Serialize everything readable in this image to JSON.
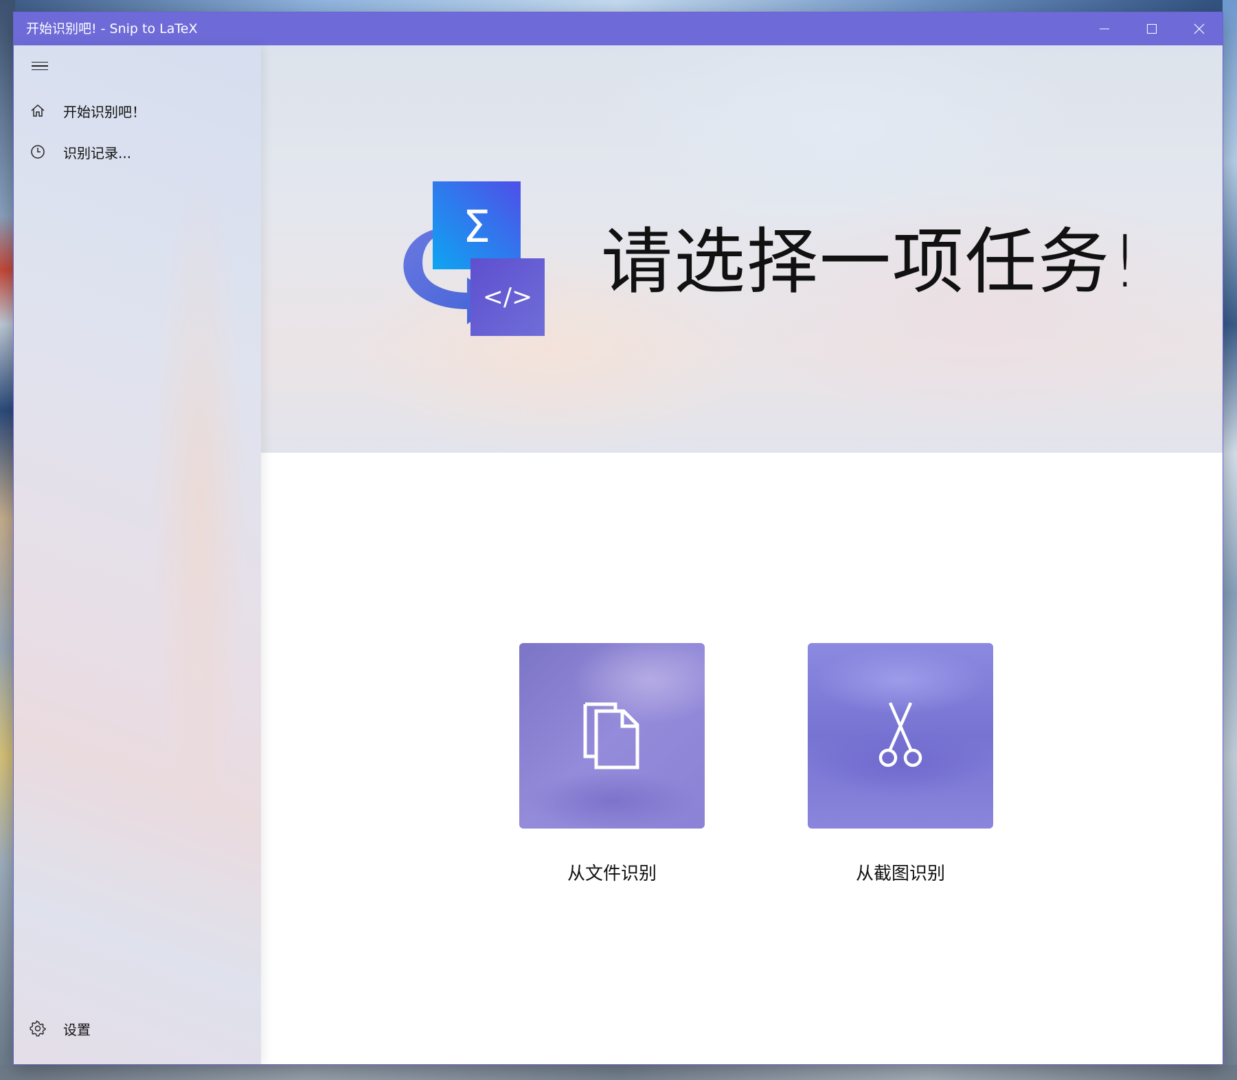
{
  "window": {
    "title": "开始识别吧! - Snip to LaTeX",
    "controls": {
      "minimize_icon": "minimize-icon",
      "maximize_icon": "maximize-icon",
      "close_icon": "close-icon"
    }
  },
  "sidebar": {
    "menu_icon": "hamburger-menu-icon",
    "items": [
      {
        "label": "开始识别吧！",
        "icon": "home-icon"
      },
      {
        "label": "识别记录...",
        "icon": "clock-icon"
      }
    ],
    "footer": {
      "label": "设置",
      "icon": "gear-icon"
    }
  },
  "hero": {
    "logo_icon": "snip-to-latex-logo",
    "logo_glyphs": {
      "sigma": "Σ",
      "code": "</>"
    },
    "title": "请选择一项任务!"
  },
  "tasks": [
    {
      "label": "从文件识别",
      "icon": "files-icon"
    },
    {
      "label": "从截图识别",
      "icon": "scissors-icon"
    }
  ],
  "colors": {
    "titlebar": "#6e6bd8",
    "accent": "#6e6bd8",
    "card_primary": "#8b82d6",
    "logo_blue": "#1a7cf0",
    "logo_purple": "#6a5fd0"
  }
}
